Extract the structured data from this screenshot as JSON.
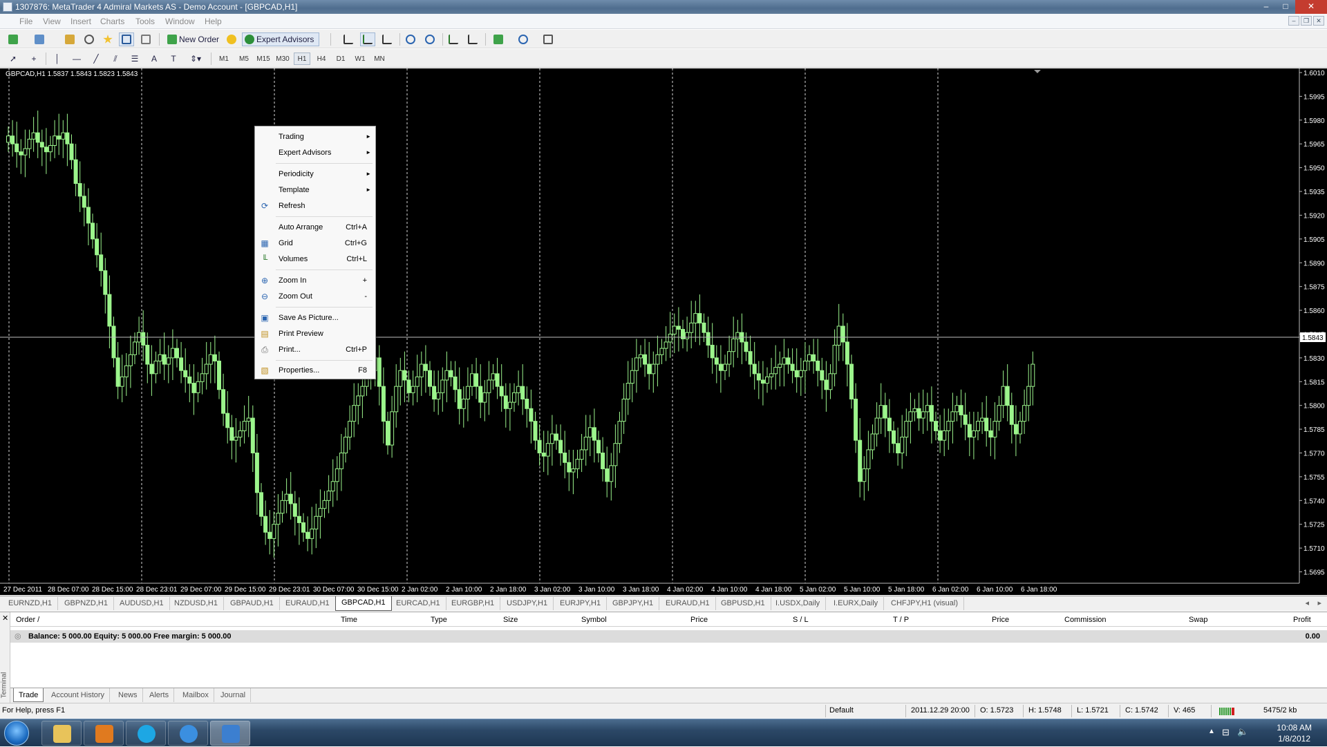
{
  "window": {
    "title": "1307876: MetaTrader 4 Admiral Markets AS - Demo Account - [GBPCAD,H1]",
    "controls": {
      "minimize": "–",
      "maximize": "□",
      "close": "✕"
    }
  },
  "menu": [
    "File",
    "View",
    "Insert",
    "Charts",
    "Tools",
    "Window",
    "Help"
  ],
  "toolbar": {
    "new_order": "New Order",
    "expert_advisors": "Expert Advisors",
    "timeframes": [
      "M1",
      "M5",
      "M15",
      "M30",
      "H1",
      "H4",
      "D1",
      "W1",
      "MN"
    ],
    "active_timeframe": "H1",
    "drawing_text_tool": "A"
  },
  "chart": {
    "info": "GBPCAD,H1  1.5837 1.5843 1.5823 1.5843",
    "current_price": "1.5843",
    "colors": {
      "background": "#000000",
      "bull": "#9cf58c",
      "bear": "#000000",
      "grid": "#ffffff",
      "bid_line": "#c0c0c0"
    },
    "price_labels": [
      "1.6010",
      "1.5995",
      "1.5980",
      "1.5965",
      "1.5950",
      "1.5935",
      "1.5920",
      "1.5905",
      "1.5890",
      "1.5875",
      "1.5860",
      "1.5845",
      "1.5830",
      "1.5815",
      "1.5800",
      "1.5785",
      "1.5770",
      "1.5755",
      "1.5740",
      "1.5725",
      "1.5710",
      "1.5695"
    ],
    "time_labels": [
      "27 Dec 2011",
      "28 Dec 07:00",
      "28 Dec 15:00",
      "28 Dec 23:01",
      "29 Dec 07:00",
      "29 Dec 15:00",
      "29 Dec 23:01",
      "30 Dec 07:00",
      "30 Dec 15:00",
      "2 Jan 02:00",
      "2 Jan 10:00",
      "2 Jan 18:00",
      "3 Jan 02:00",
      "3 Jan 10:00",
      "3 Jan 18:00",
      "4 Jan 02:00",
      "4 Jan 10:00",
      "4 Jan 18:00",
      "5 Jan 02:00",
      "5 Jan 10:00",
      "5 Jan 18:00",
      "6 Jan 02:00",
      "6 Jan 10:00",
      "6 Jan 18:00"
    ]
  },
  "chart_data": {
    "type": "candlestick",
    "symbol": "GBPCAD",
    "timeframe": "H1",
    "ylim": [
      1.569,
      1.601
    ],
    "close": [
      1.597,
      1.5965,
      1.596,
      1.5958,
      1.5962,
      1.5968,
      1.5972,
      1.5966,
      1.5963,
      1.596,
      1.5964,
      1.597,
      1.5968,
      1.5972,
      1.5965,
      1.5955,
      1.594,
      1.5932,
      1.5925,
      1.5915,
      1.5905,
      1.5895,
      1.5885,
      1.587,
      1.585,
      1.583,
      1.5812,
      1.5818,
      1.5825,
      1.5832,
      1.584,
      1.5846,
      1.5838,
      1.5826,
      1.582,
      1.5828,
      1.5832,
      1.5826,
      1.583,
      1.5836,
      1.583,
      1.5822,
      1.5818,
      1.5814,
      1.5808,
      1.5815,
      1.582,
      1.5826,
      1.5832,
      1.5828,
      1.581,
      1.5795,
      1.5786,
      1.5778,
      1.578,
      1.5784,
      1.579,
      1.5792,
      1.577,
      1.5745,
      1.573,
      1.572,
      1.5716,
      1.5725,
      1.5732,
      1.574,
      1.5744,
      1.5738,
      1.573,
      1.5726,
      1.572,
      1.5716,
      1.5722,
      1.573,
      1.5735,
      1.574,
      1.5746,
      1.5752,
      1.576,
      1.577,
      1.578,
      1.579,
      1.58,
      1.5806,
      1.5812,
      1.5818,
      1.5822,
      1.583,
      1.5812,
      1.579,
      1.5775,
      1.5796,
      1.5812,
      1.5822,
      1.5816,
      1.5808,
      1.5812,
      1.5818,
      1.5826,
      1.5822,
      1.5812,
      1.5804,
      1.5808,
      1.5816,
      1.5822,
      1.5818,
      1.581,
      1.5798,
      1.5804,
      1.5812,
      1.582,
      1.5812,
      1.5802,
      1.5808,
      1.5816,
      1.582,
      1.5812,
      1.5806,
      1.5798,
      1.5802,
      1.5808,
      1.5812,
      1.5804,
      1.5798,
      1.579,
      1.5778,
      1.577,
      1.5768,
      1.5776,
      1.5782,
      1.5778,
      1.577,
      1.5764,
      1.5758,
      1.576,
      1.5766,
      1.5772,
      1.578,
      1.5786,
      1.5778,
      1.577,
      1.576,
      1.5752,
      1.5762,
      1.5776,
      1.579,
      1.5804,
      1.5814,
      1.5822,
      1.583,
      1.5832,
      1.5826,
      1.582,
      1.5826,
      1.5832,
      1.5836,
      1.584,
      1.5845,
      1.585,
      1.5848,
      1.5842,
      1.5846,
      1.5852,
      1.5858,
      1.5852,
      1.5846,
      1.5838,
      1.583,
      1.5826,
      1.5822,
      1.5826,
      1.5834,
      1.5842,
      1.5846,
      1.584,
      1.5834,
      1.5826,
      1.582,
      1.5816,
      1.5814,
      1.5818,
      1.582,
      1.5824,
      1.5826,
      1.583,
      1.5826,
      1.5822,
      1.5818,
      1.5822,
      1.5828,
      1.5832,
      1.5828,
      1.5822,
      1.5816,
      1.581,
      1.582,
      1.5838,
      1.585,
      1.584,
      1.5826,
      1.5804,
      1.5778,
      1.5752,
      1.576,
      1.5772,
      1.5782,
      1.5792,
      1.58,
      1.5792,
      1.5784,
      1.5776,
      1.577,
      1.578,
      1.579,
      1.5796,
      1.5798,
      1.5792,
      1.5796,
      1.58,
      1.579,
      1.5784,
      1.5778,
      1.5784,
      1.579,
      1.5796,
      1.58,
      1.5794,
      1.5788,
      1.578,
      1.5784,
      1.579,
      1.5792,
      1.5784,
      1.578,
      1.579,
      1.58,
      1.5812,
      1.58,
      1.5788,
      1.5782,
      1.579,
      1.58,
      1.5812,
      1.5826,
      1.5836,
      1.5843
    ]
  },
  "context_menu": {
    "items": [
      {
        "label": "Trading",
        "submenu": true
      },
      {
        "label": "Expert Advisors",
        "submenu": true
      },
      {
        "label": "Periodicity",
        "submenu": true
      },
      {
        "label": "Template",
        "submenu": true
      },
      {
        "label": "Refresh",
        "icon": "refresh-icon"
      },
      {
        "label": "Auto Arrange",
        "shortcut": "Ctrl+A"
      },
      {
        "label": "Grid",
        "shortcut": "Ctrl+G",
        "icon": "grid-icon"
      },
      {
        "label": "Volumes",
        "shortcut": "Ctrl+L",
        "icon": "volumes-icon"
      },
      {
        "label": "Zoom In",
        "shortcut": "+",
        "icon": "zoom-in-icon"
      },
      {
        "label": "Zoom Out",
        "shortcut": "-",
        "icon": "zoom-out-icon"
      },
      {
        "label": "Save As Picture...",
        "icon": "save-picture-icon"
      },
      {
        "label": "Print Preview",
        "icon": "print-preview-icon"
      },
      {
        "label": "Print...",
        "shortcut": "Ctrl+P",
        "icon": "print-icon"
      },
      {
        "label": "Properties...",
        "shortcut": "F8",
        "icon": "properties-icon"
      }
    ],
    "submenu_arrow": "►"
  },
  "chart_tabs": [
    "EURNZD,H1",
    "GBPNZD,H1",
    "AUDUSD,H1",
    "NZDUSD,H1",
    "GBPAUD,H1",
    "EURAUD,H1",
    "GBPCAD,H1",
    "EURCAD,H1",
    "EURGBP,H1",
    "USDJPY,H1",
    "EURJPY,H1",
    "GBPJPY,H1",
    "EURAUD,H1",
    "GBPUSD,H1",
    "I.USDX,Daily",
    "I.EURX,Daily",
    "CHFJPY,H1 (visual)"
  ],
  "active_chart_tab": "GBPCAD,H1",
  "tab_scroll": {
    "left": "◂",
    "right": "▸"
  },
  "terminal": {
    "side_label": "Terminal",
    "close": "✕",
    "columns": [
      "Order  /",
      "Time",
      "Type",
      "Size",
      "Symbol",
      "Price",
      "S / L",
      "T / P",
      "Price",
      "Commission",
      "Swap",
      "Profit"
    ],
    "balance_text": "Balance: 5 000.00  Equity: 5 000.00  Free margin: 5 000.00",
    "profit": "0.00",
    "tabs": [
      "Trade",
      "Account History",
      "News",
      "Alerts",
      "Mailbox",
      "Journal"
    ],
    "active_tab": "Trade"
  },
  "statusbar": {
    "help": "For Help, press F1",
    "profile": "Default",
    "datetime": "2011.12.29 20:00",
    "open": "O: 1.5723",
    "high": "H: 1.5748",
    "low": "L: 1.5721",
    "close": "C: 1.5742",
    "volume": "V: 465",
    "traffic": "5475/2 kb"
  },
  "taskbar": {
    "time": "10:08 AM",
    "date": "1/8/2012",
    "tray_arrow": "▲"
  }
}
